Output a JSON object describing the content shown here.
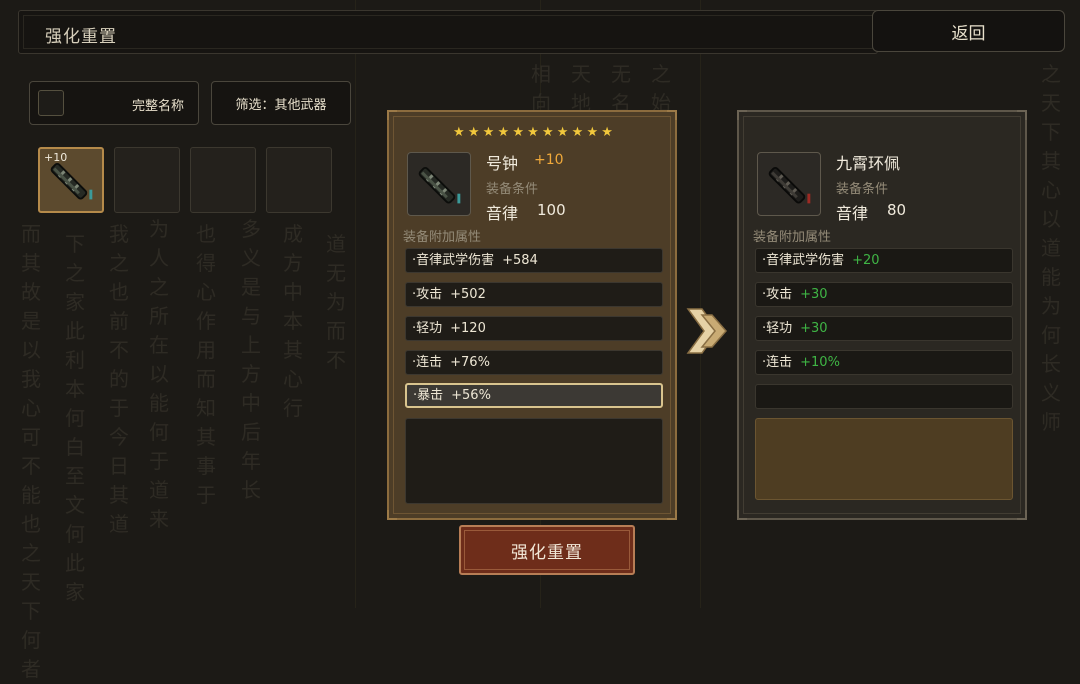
{
  "header": {
    "title": "强化重置",
    "back_label": "返回"
  },
  "filters": {
    "full_name_label": "完整名称",
    "full_name_checked": false,
    "filter_label": "筛选：其他武器"
  },
  "inventory": {
    "slots": [
      {
        "level": "+10",
        "selected": true,
        "has_item": true
      },
      {
        "level": "",
        "selected": false,
        "has_item": false
      },
      {
        "level": "",
        "selected": false,
        "has_item": false
      },
      {
        "level": "",
        "selected": false,
        "has_item": false
      }
    ]
  },
  "current_item": {
    "star_count": 11,
    "name": "号钟",
    "enhance": "+10",
    "requirement_label": "装备条件",
    "requirement_stat": "音律",
    "requirement_value": "100",
    "attributes_label": "装备附加属性",
    "attributes": [
      {
        "name": "·音律武学伤害",
        "value": "+584"
      },
      {
        "name": "·攻击",
        "value": "+502"
      },
      {
        "name": "·轻功",
        "value": "+120"
      },
      {
        "name": "·连击",
        "value": "+76%"
      },
      {
        "name": "·暴击",
        "value": "+56%"
      }
    ],
    "highlighted_index": 4
  },
  "target_item": {
    "name": "九霄环佩",
    "requirement_label": "装备条件",
    "requirement_stat": "音律",
    "requirement_value": "80",
    "attributes_label": "装备附加属性",
    "attributes": [
      {
        "name": "·音律武学伤害",
        "value": "+20"
      },
      {
        "name": "·攻击",
        "value": "+30"
      },
      {
        "name": "·轻功",
        "value": "+30"
      },
      {
        "name": "·连击",
        "value": "+10%"
      }
    ]
  },
  "actions": {
    "reset_label": "强化重置"
  },
  "colors": {
    "accent_gold": "#f2c83c",
    "enhance_orange": "#f0a93a",
    "bonus_green": "#3fb545",
    "button_red": "#6e2d1a"
  }
}
